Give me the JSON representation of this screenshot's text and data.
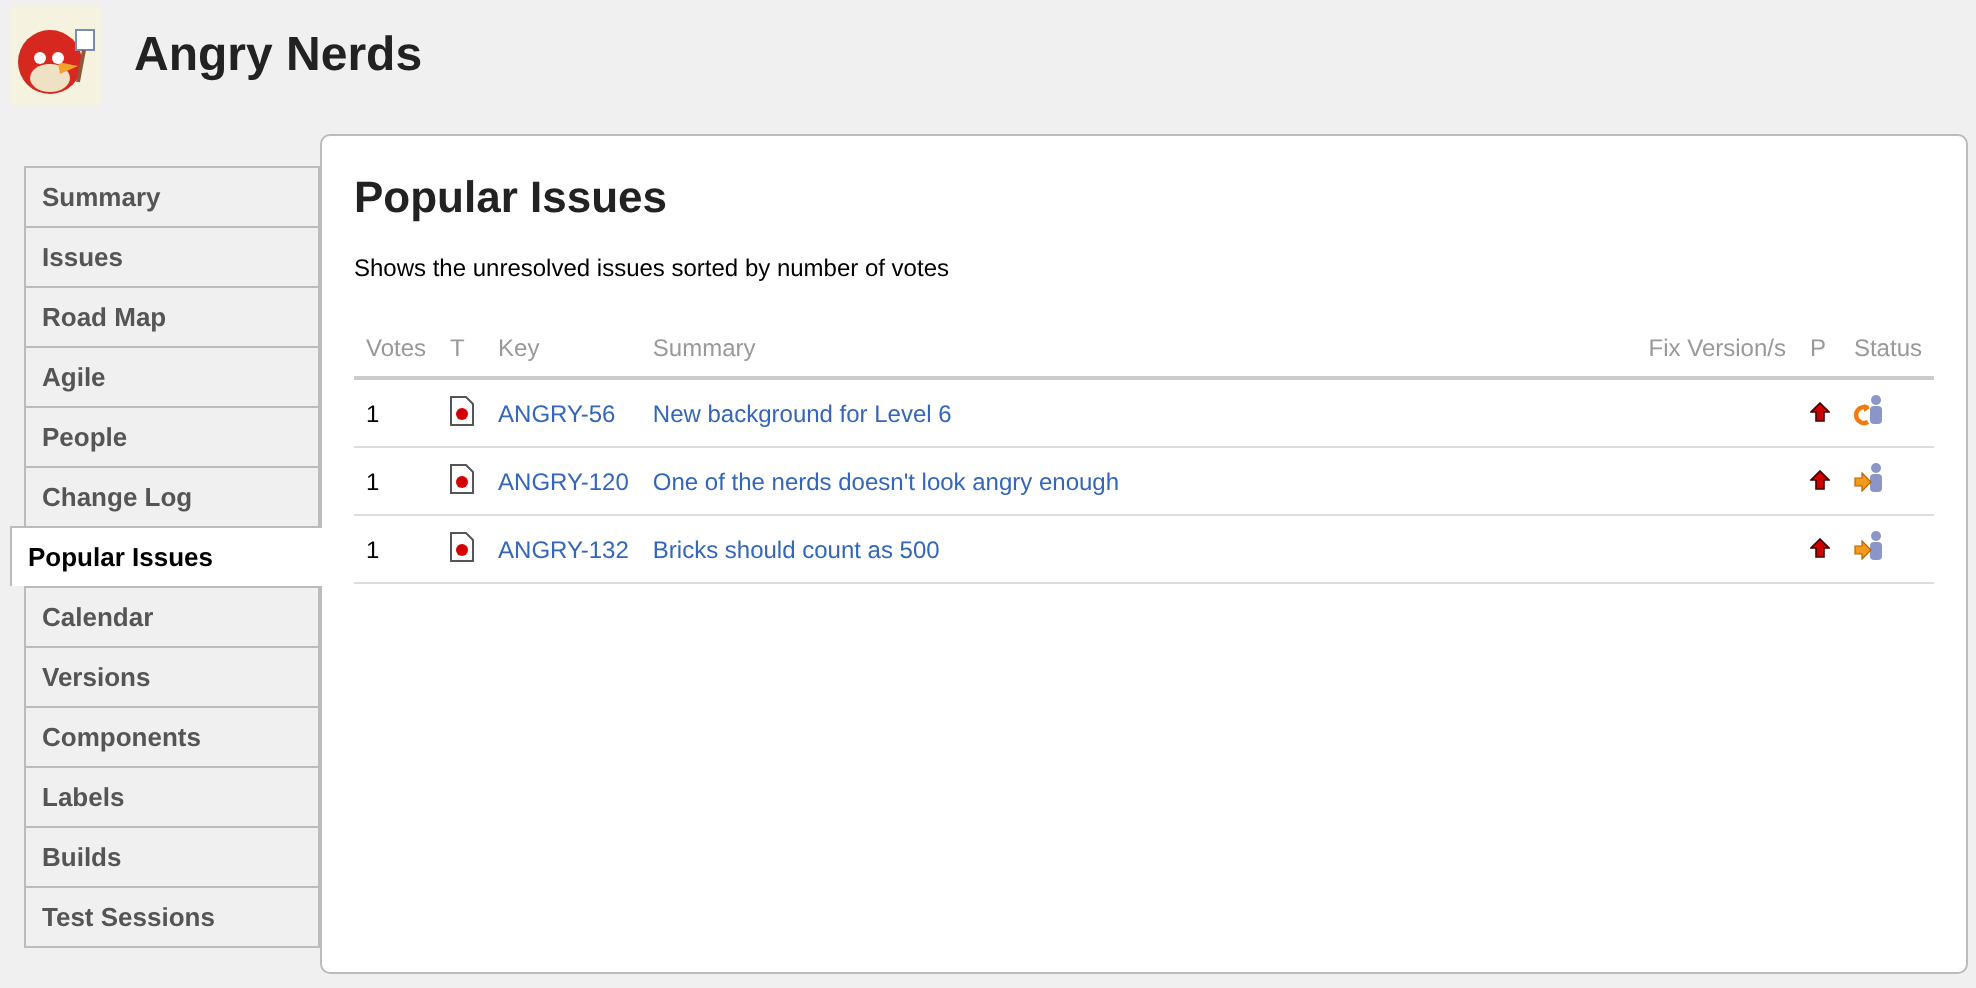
{
  "project": {
    "name": "Angry Nerds"
  },
  "sidebar": {
    "items": [
      {
        "label": "Summary",
        "selected": false
      },
      {
        "label": "Issues",
        "selected": false
      },
      {
        "label": "Road Map",
        "selected": false
      },
      {
        "label": "Agile",
        "selected": false
      },
      {
        "label": "People",
        "selected": false
      },
      {
        "label": "Change Log",
        "selected": false
      },
      {
        "label": "Popular Issues",
        "selected": true
      },
      {
        "label": "Calendar",
        "selected": false
      },
      {
        "label": "Versions",
        "selected": false
      },
      {
        "label": "Components",
        "selected": false
      },
      {
        "label": "Labels",
        "selected": false
      },
      {
        "label": "Builds",
        "selected": false
      },
      {
        "label": "Test Sessions",
        "selected": false
      }
    ]
  },
  "content": {
    "title": "Popular Issues",
    "description": "Shows the unresolved issues sorted by number of votes",
    "table": {
      "columns": [
        "Votes",
        "T",
        "Key",
        "Summary",
        "Fix Version/s",
        "P",
        "Status"
      ],
      "rows": [
        {
          "votes": "1",
          "key": "ANGRY-56",
          "summary": "New background for Level 6",
          "status": {
            "kind": "reopened"
          }
        },
        {
          "votes": "1",
          "key": "ANGRY-120",
          "summary": "One of the nerds doesn't look angry enough",
          "status": {
            "kind": "in_progress"
          }
        },
        {
          "votes": "1",
          "key": "ANGRY-132",
          "summary": "Bricks should count as 500",
          "status": {
            "kind": "in_progress"
          }
        }
      ]
    }
  }
}
